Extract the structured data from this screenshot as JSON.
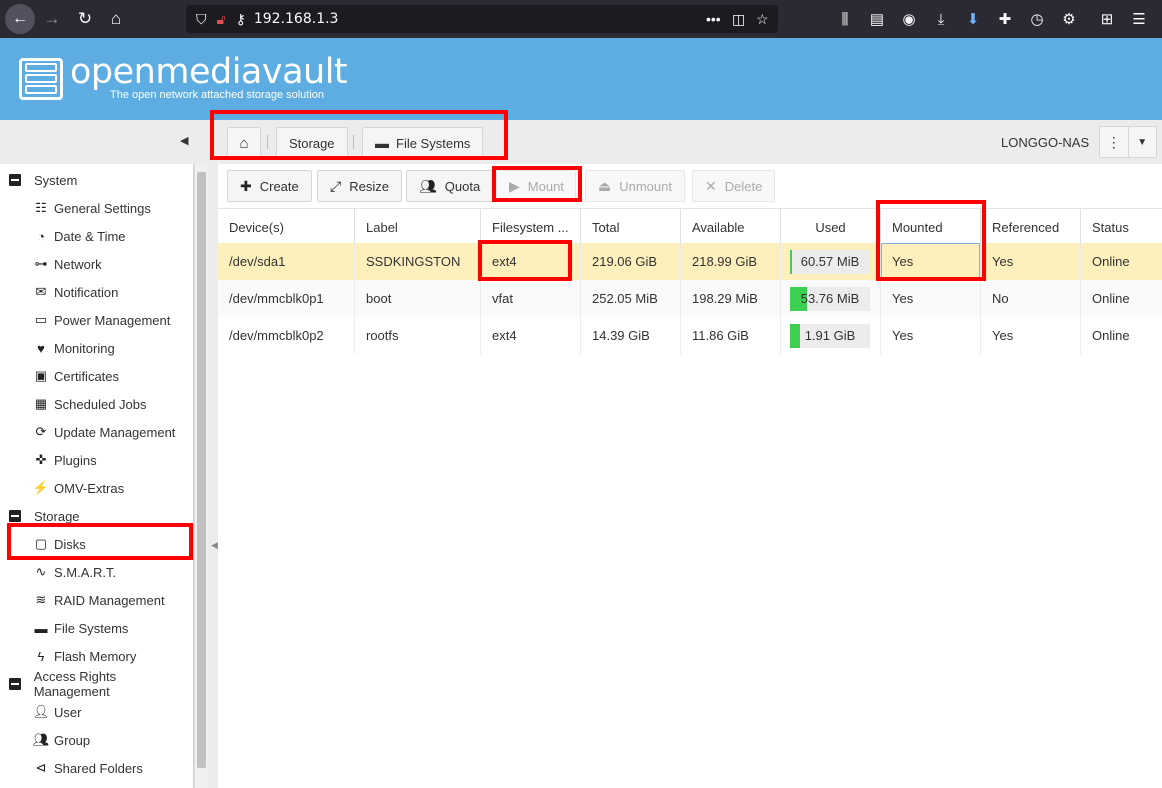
{
  "browser": {
    "url": "192.168.1.3"
  },
  "brand": {
    "name": "openmediavault",
    "tagline": "The open network attached storage solution"
  },
  "breadcrumb": {
    "storage": "Storage",
    "filesystems": "File Systems"
  },
  "host": "LONGGO-NAS",
  "sidebar": {
    "groups": [
      {
        "label": "System"
      },
      {
        "label": "Storage"
      },
      {
        "label": "Access Rights Management"
      }
    ],
    "system_items": [
      {
        "label": "General Settings",
        "icon": "sliders-icon"
      },
      {
        "label": "Date & Time",
        "icon": "clock-icon"
      },
      {
        "label": "Network",
        "icon": "network-icon"
      },
      {
        "label": "Notification",
        "icon": "mail-icon"
      },
      {
        "label": "Power Management",
        "icon": "battery-icon"
      },
      {
        "label": "Monitoring",
        "icon": "heartbeat-icon"
      },
      {
        "label": "Certificates",
        "icon": "certificate-icon"
      },
      {
        "label": "Scheduled Jobs",
        "icon": "calendar-icon"
      },
      {
        "label": "Update Management",
        "icon": "refresh-icon"
      },
      {
        "label": "Plugins",
        "icon": "puzzle-icon"
      },
      {
        "label": "OMV-Extras",
        "icon": "plug-icon"
      }
    ],
    "storage_items": [
      {
        "label": "Disks",
        "icon": "disk-icon"
      },
      {
        "label": "S.M.A.R.T.",
        "icon": "pulse-icon"
      },
      {
        "label": "RAID Management",
        "icon": "database-icon"
      },
      {
        "label": "File Systems",
        "icon": "folder-icon"
      },
      {
        "label": "Flash Memory",
        "icon": "flash-icon"
      }
    ],
    "access_items": [
      {
        "label": "User",
        "icon": "user-icon"
      },
      {
        "label": "Group",
        "icon": "group-icon"
      },
      {
        "label": "Shared Folders",
        "icon": "share-icon"
      }
    ]
  },
  "actions": {
    "create": "Create",
    "resize": "Resize",
    "quota": "Quota",
    "mount": "Mount",
    "unmount": "Unmount",
    "delete": "Delete"
  },
  "table": {
    "columns": [
      "Device(s)",
      "Label",
      "Filesystem ...",
      "Total",
      "Available",
      "Used",
      "Mounted",
      "Referenced",
      "Status"
    ],
    "rows": [
      {
        "device": "/dev/sda1",
        "label": "SSDKINGSTON",
        "fs": "ext4",
        "total": "219.06 GiB",
        "available": "218.99 GiB",
        "used": "60.57 MiB",
        "used_fraction": 0.003,
        "mounted": "Yes",
        "referenced": "Yes",
        "status": "Online"
      },
      {
        "device": "/dev/mmcblk0p1",
        "label": "boot",
        "fs": "vfat",
        "total": "252.05 MiB",
        "available": "198.29 MiB",
        "used": "53.76 MiB",
        "used_fraction": 0.21,
        "mounted": "Yes",
        "referenced": "No",
        "status": "Online"
      },
      {
        "device": "/dev/mmcblk0p2",
        "label": "rootfs",
        "fs": "ext4",
        "total": "14.39 GiB",
        "available": "11.86 GiB",
        "used": "1.91 GiB",
        "used_fraction": 0.13,
        "mounted": "Yes",
        "referenced": "Yes",
        "status": "Online"
      }
    ]
  },
  "colors": {
    "banner": "#5dade2",
    "selected_row": "#fdf0bd",
    "usage_fill": "#3ccf50",
    "highlight": "#ff0000"
  }
}
